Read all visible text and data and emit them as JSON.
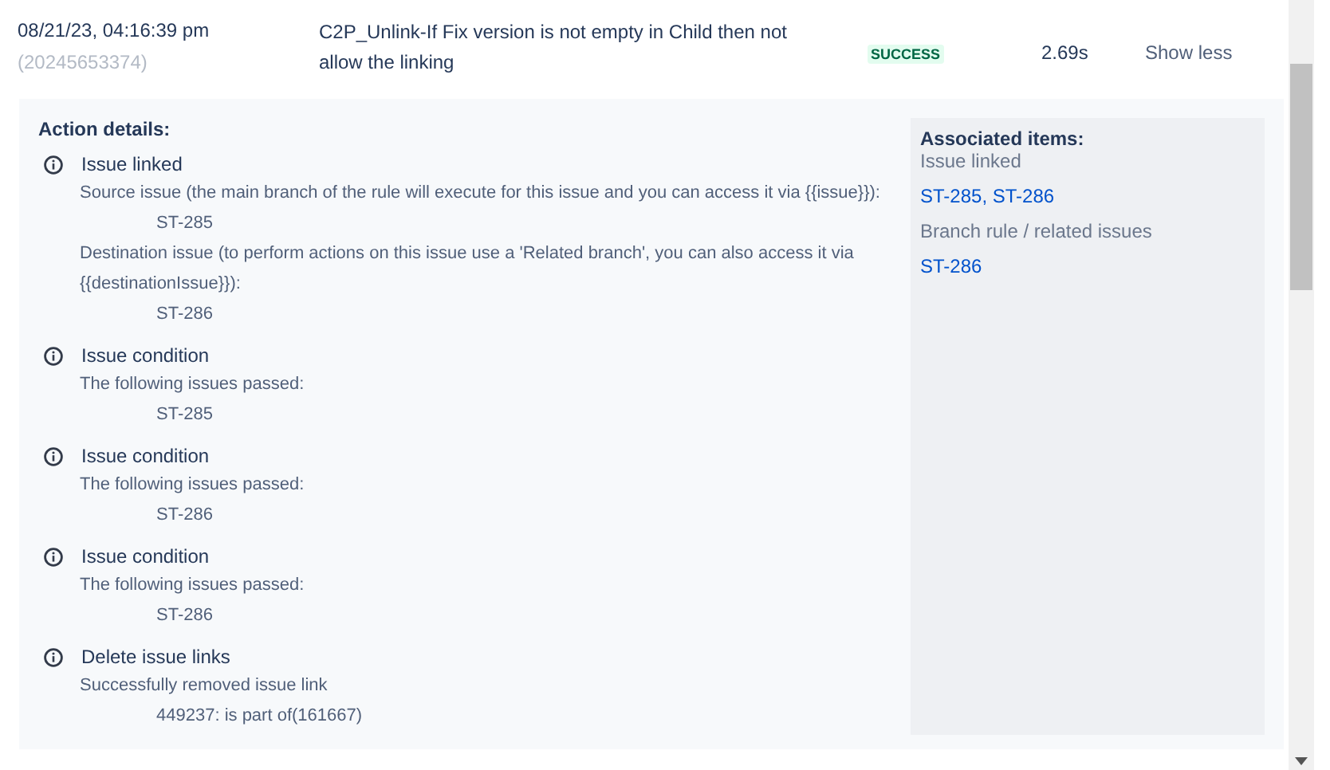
{
  "log_row": {
    "timestamp": "08/21/23, 04:16:39 pm",
    "run_id": "(20245653374)",
    "rule_name": "C2P_Unlink-If Fix version is not empty in Child then not allow the linking",
    "status": {
      "label": "SUCCESS",
      "kind": "success"
    },
    "duration": "2.69s",
    "toggle_link": "Show less"
  },
  "action_details": {
    "heading": "Action details:",
    "actions": [
      {
        "title": "Issue linked",
        "entries": [
          {
            "description": "Source issue (the main branch of the rule will execute for this issue and you can access it via {{issue}}):",
            "value": "ST-285"
          },
          {
            "description": "Destination issue (to perform actions on this issue use a 'Related branch', you can also access it via {{destinationIssue}}):",
            "value": "ST-286"
          }
        ]
      },
      {
        "title": "Issue condition",
        "entries": [
          {
            "description": "The following issues passed:",
            "value": "ST-285"
          }
        ]
      },
      {
        "title": "Issue condition",
        "entries": [
          {
            "description": "The following issues passed:",
            "value": "ST-286"
          }
        ]
      },
      {
        "title": "Issue condition",
        "entries": [
          {
            "description": "The following issues passed:",
            "value": "ST-286"
          }
        ]
      },
      {
        "title": "Delete issue links",
        "entries": [
          {
            "description": "Successfully removed issue link",
            "value": "449237: is part of(161667)"
          }
        ]
      }
    ]
  },
  "associated_items": {
    "heading": "Associated items:",
    "groups": [
      {
        "label": "Issue linked",
        "links": "ST-285, ST-286"
      },
      {
        "label": "Branch rule / related issues",
        "links": "ST-286"
      }
    ]
  }
}
